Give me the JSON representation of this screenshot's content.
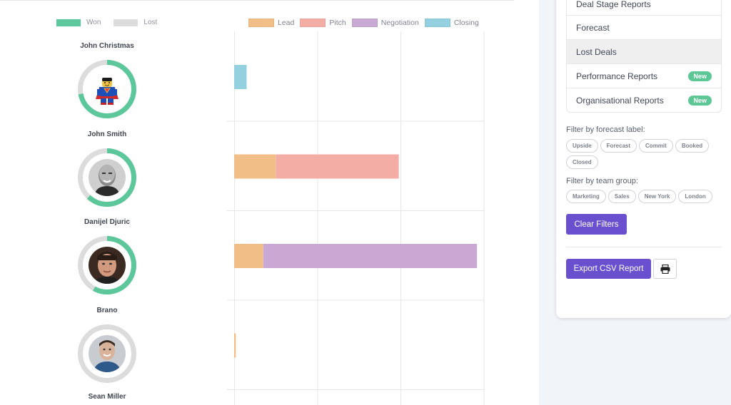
{
  "legend_winloss": {
    "won": {
      "label": "Won",
      "color": "#5bc79b"
    },
    "lost": {
      "label": "Lost",
      "color": "#dcdcdc"
    }
  },
  "people": [
    {
      "name": "John Christmas",
      "won_fraction": 0.72,
      "avatar": "lego-superman-avatar"
    },
    {
      "name": "John Smith",
      "won_fraction": 0.62,
      "avatar": "bald-man-avatar"
    },
    {
      "name": "Danijel Djuric",
      "won_fraction": 0.58,
      "avatar": "dark-hair-man-avatar"
    },
    {
      "name": "Brano",
      "won_fraction": 0.0,
      "avatar": "smiling-man-avatar"
    },
    {
      "name": "Sean Miller"
    }
  ],
  "chart_data": {
    "type": "bar",
    "orientation": "horizontal",
    "stacked": true,
    "legend": [
      "Lead",
      "Pitch",
      "Negotiation",
      "Closing"
    ],
    "colors": {
      "Lead": "#f2be88",
      "Pitch": "#f4ada4",
      "Negotiation": "#c9a8d4",
      "Closing": "#94d1e0"
    },
    "xlim": [
      0,
      3
    ],
    "grid": true,
    "rows": [
      {
        "Lead": 0,
        "Pitch": 0,
        "Negotiation": 0,
        "Closing": 0.15
      },
      {
        "Lead": 0.5,
        "Pitch": 1.48,
        "Negotiation": 0,
        "Closing": 0
      },
      {
        "Lead": 0.35,
        "Pitch": 0,
        "Negotiation": 2.57,
        "Closing": 0
      },
      {
        "Lead": 0.02,
        "Pitch": 0,
        "Negotiation": 0,
        "Closing": 0
      }
    ]
  },
  "sidebar": {
    "menu": [
      {
        "label": "Deal Stage Reports",
        "active": false,
        "badge": ""
      },
      {
        "label": "Forecast",
        "active": false,
        "badge": ""
      },
      {
        "label": "Lost Deals",
        "active": true,
        "badge": ""
      },
      {
        "label": "Performance Reports",
        "active": false,
        "badge": "New"
      },
      {
        "label": "Organisational Reports",
        "active": false,
        "badge": "New"
      }
    ],
    "forecast_filter_label": "Filter by forecast label:",
    "forecast_labels": [
      "Upside",
      "Forecast",
      "Commit",
      "Booked",
      "Closed"
    ],
    "team_filter_label": "Filter by team group:",
    "team_groups": [
      "Marketing",
      "Sales",
      "New York",
      "London"
    ],
    "clear_filters_label": "Clear Filters",
    "export_label": "Export CSV Report",
    "print_icon": "printer-icon",
    "accent": "#6a4fcf"
  }
}
